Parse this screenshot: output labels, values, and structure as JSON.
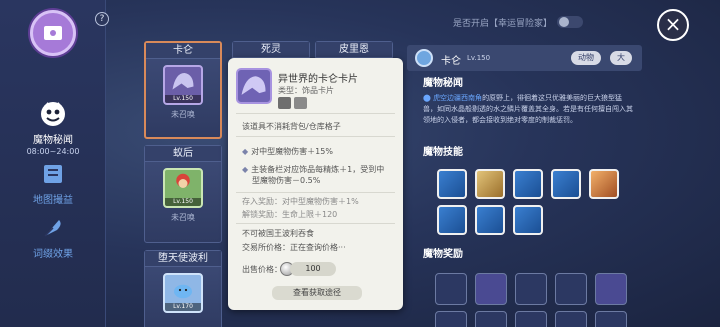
{
  "sidebar": {
    "items": [
      {
        "label": "魔物秘闻",
        "time": "08:00~24:00",
        "icon": "monster-face-icon"
      },
      {
        "label": "地图撮益",
        "icon": "map-book-icon"
      },
      {
        "label": "词缀效果",
        "icon": "feather-icon"
      }
    ],
    "help": "?"
  },
  "cards": [
    {
      "name": "卡仑",
      "lv": "Lv.150",
      "status": "未召唤"
    },
    {
      "name": "死灵"
    },
    {
      "name": "皮里恩"
    },
    {
      "name": "蚁后",
      "lv": "Lv.150",
      "status": "未召唤"
    },
    {
      "name": "堕天使波利",
      "lv": "Lv.170"
    }
  ],
  "popup": {
    "title": "异世界的卡仑卡片",
    "type": "类型：饰品卡片",
    "line1": "该道具不消耗背包/仓库格子",
    "bullet1": "对中型魔物伤害＋15%",
    "bullet2a": "主装备栏对应饰品每精炼＋1，受到中",
    "bullet2b": "型魔物伤害－0.5%",
    "deposit": "存入奖励：对中型魔物伤害＋1%",
    "unlock": "解锁奖励：生命上限＋120",
    "no_devour": "不可被国王波利吞食",
    "trade": "交易所价格：正在查询价格···",
    "sell_label": "出售价格：",
    "sell_price": "100",
    "button": "查看获取途径"
  },
  "header": {
    "toggle_label": "是否开启【幸运冒险家】",
    "close": "×"
  },
  "detail": {
    "name": "卡仑",
    "lv": "Lv.150",
    "tag1": "动物",
    "tag2": "大",
    "sec1": "魔物秘闻",
    "location": "虎空边疆西南角",
    "desc": "的原野上，徘徊着这只优雅美丽的巨大狼型猛兽，如同水晶般剔透的水之鳞片覆盖其全身。若是有任何擅自闯入其领地的入侵者，都会接收到绝对零度的制裁惩罚。",
    "sec2": "魔物技能",
    "sec3": "魔物奖励"
  },
  "colors": {
    "accent": "#a67ad8",
    "selected_border": "#d98a5a",
    "link": "#6aa7ff"
  }
}
